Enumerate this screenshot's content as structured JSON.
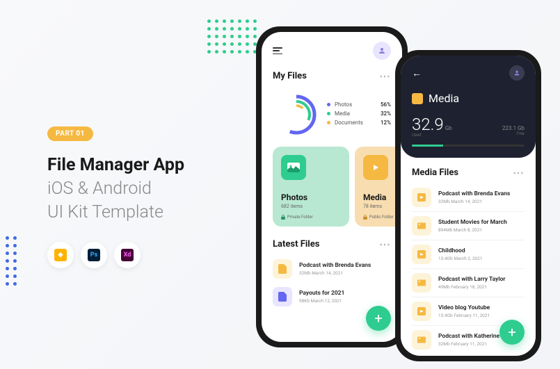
{
  "badge": "PART 01",
  "title": "File Manager App",
  "subtitle1": "iOS & Android",
  "subtitle2": "UI Kit Template",
  "phone1": {
    "section": "My Files",
    "legend": [
      {
        "label": "Photos",
        "val": "56%",
        "color": "#6366f1"
      },
      {
        "label": "Media",
        "val": "32%",
        "color": "#2ecc8f"
      },
      {
        "label": "Documents",
        "val": "12%",
        "color": "#f5b942"
      }
    ],
    "cards": [
      {
        "title": "Photos",
        "sub": "682 items",
        "footer": "Private Folder"
      },
      {
        "title": "Media",
        "sub": "78 items",
        "footer": "Public Folder"
      }
    ],
    "latest": "Latest Files",
    "files": [
      {
        "name": "Podcast with Brenda Evans",
        "meta": "32Mb March 14, 2021",
        "bg": "#fdf3d8"
      },
      {
        "name": "Payouts for 2021",
        "meta": "98Kb March 12, 2021",
        "bg": "#e8e5ff"
      }
    ]
  },
  "phone2": {
    "title": "Media",
    "used_val": "32.9",
    "used_unit": "Gb",
    "used_lbl": "Used",
    "free_val": "223.1 Gb",
    "free_lbl": "Free",
    "section": "Media Files",
    "files": [
      {
        "name": "Podcast with Brenda Evans",
        "meta": "32Mb March 14, 2021"
      },
      {
        "name": "Student Movies for March",
        "meta": "894Mb March 8, 2021"
      },
      {
        "name": "Childhood",
        "meta": "13.4Gb March 2, 2021"
      },
      {
        "name": "Podcast with Larry Taylor",
        "meta": "49Mb February 18, 2021"
      },
      {
        "name": "Video blog Youtube",
        "meta": "13.4Gb February 11, 2021"
      },
      {
        "name": "Podcast with Katherine Long",
        "meta": "32Mb February 11, 2021"
      }
    ]
  }
}
